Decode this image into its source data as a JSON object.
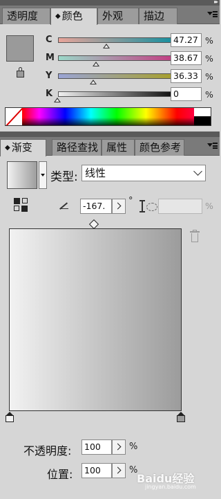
{
  "color_panel": {
    "tabs": [
      {
        "label": "透明度",
        "active": false
      },
      {
        "label": "颜色",
        "active": true
      },
      {
        "label": "外观",
        "active": false
      },
      {
        "label": "描边",
        "active": false
      }
    ],
    "swatch_color": "#9a9a9a",
    "channels": [
      {
        "label": "C",
        "value": "47.27",
        "unit": "%",
        "level": 0.4727,
        "gradient_start": "#e8a49a",
        "gradient_end": "#0a8fa0"
      },
      {
        "label": "M",
        "value": "38.67",
        "unit": "%",
        "level": 0.3867,
        "gradient_start": "#9ad7c8",
        "gradient_end": "#c5347e"
      },
      {
        "label": "Y",
        "value": "36.33",
        "unit": "%",
        "level": 0.3633,
        "gradient_start": "#9aa4d6",
        "gradient_end": "#a8a022"
      },
      {
        "label": "K",
        "value": "0",
        "unit": "%",
        "level": 0.0,
        "gradient_start": "#f0f0f0",
        "gradient_end": "#000000"
      }
    ]
  },
  "gradient_panel": {
    "tabs": [
      {
        "label": "渐变",
        "active": true
      },
      {
        "label": "路径查找",
        "active": false
      },
      {
        "label": "属性",
        "active": false
      },
      {
        "label": "颜色参考",
        "active": false
      }
    ],
    "type_label": "类型:",
    "type_value": "线性",
    "angle_value": "-167.",
    "degree_symbol": "°",
    "aspect_unit": "%",
    "gradient_start_color": "#f2f2f2",
    "gradient_end_color": "#9c9c9c",
    "opacity_label": "不透明度:",
    "opacity_value": "100",
    "opacity_unit": "%",
    "location_label": "位置:",
    "location_value": "100",
    "location_unit": "%"
  },
  "watermark": {
    "text": "Baidu经验",
    "subtext": "jingyan.baidu.com"
  }
}
